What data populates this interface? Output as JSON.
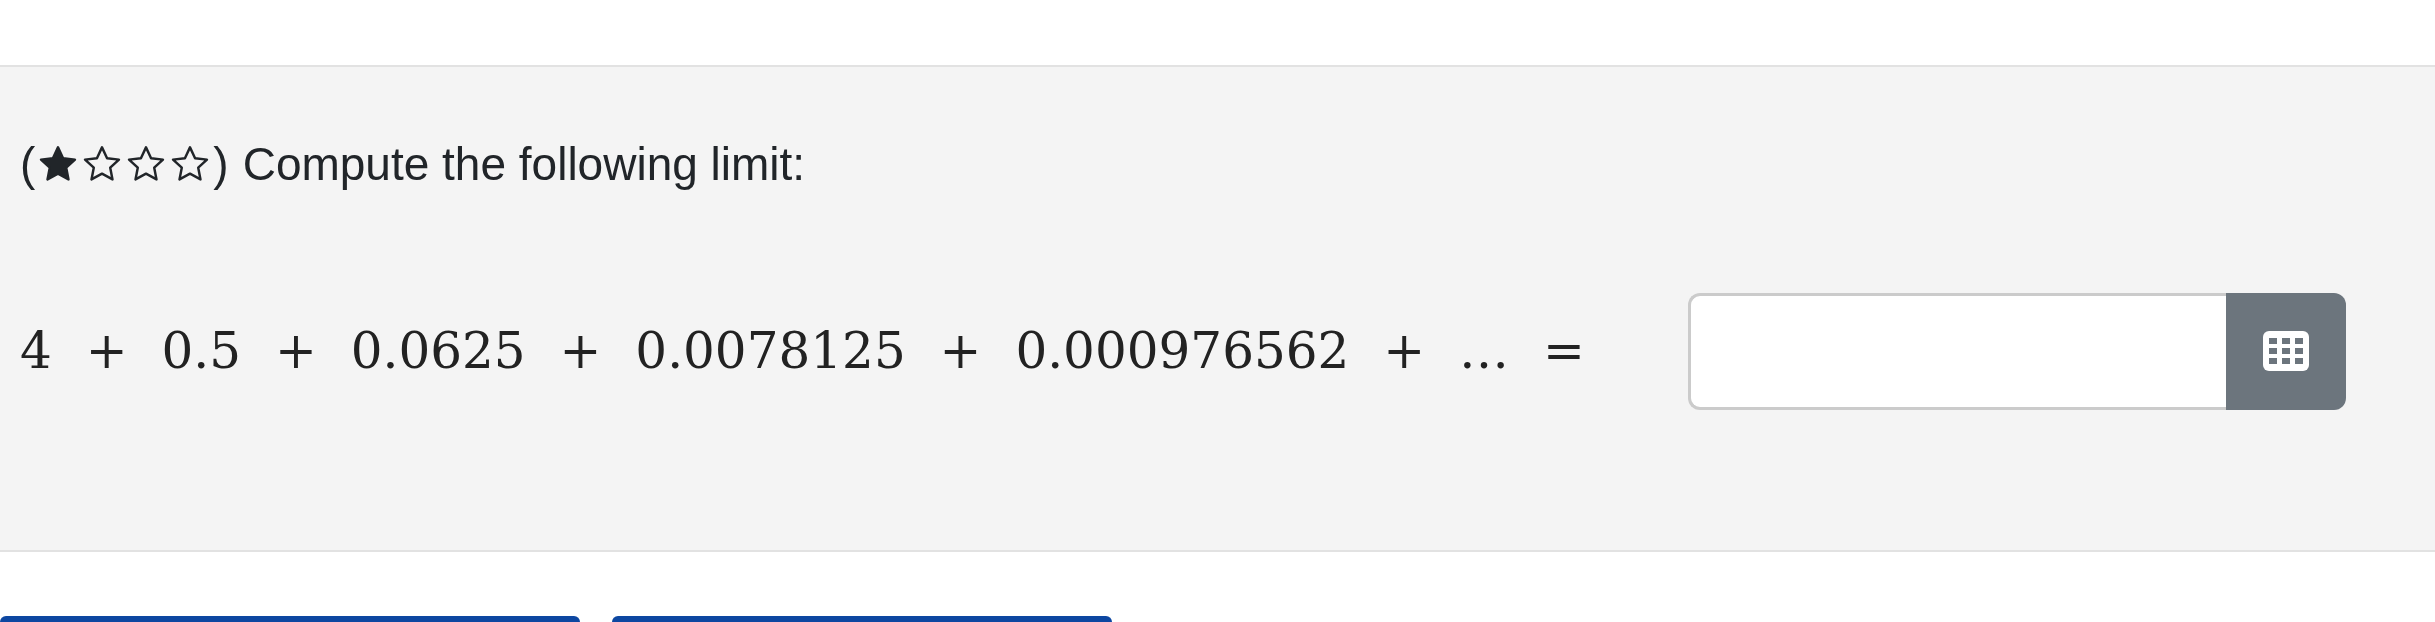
{
  "question": {
    "rating": {
      "open_bracket": "(",
      "stars": 1,
      "close_bracket": ")"
    },
    "prompt": "Compute the following limit:",
    "expression": "4 + 0.5 + 0.0625 + 0.0078125 + 0.000976562 + … ="
  },
  "footer_buttons": [
    {
      "kind": "primary"
    },
    {
      "kind": "primary"
    }
  ]
}
